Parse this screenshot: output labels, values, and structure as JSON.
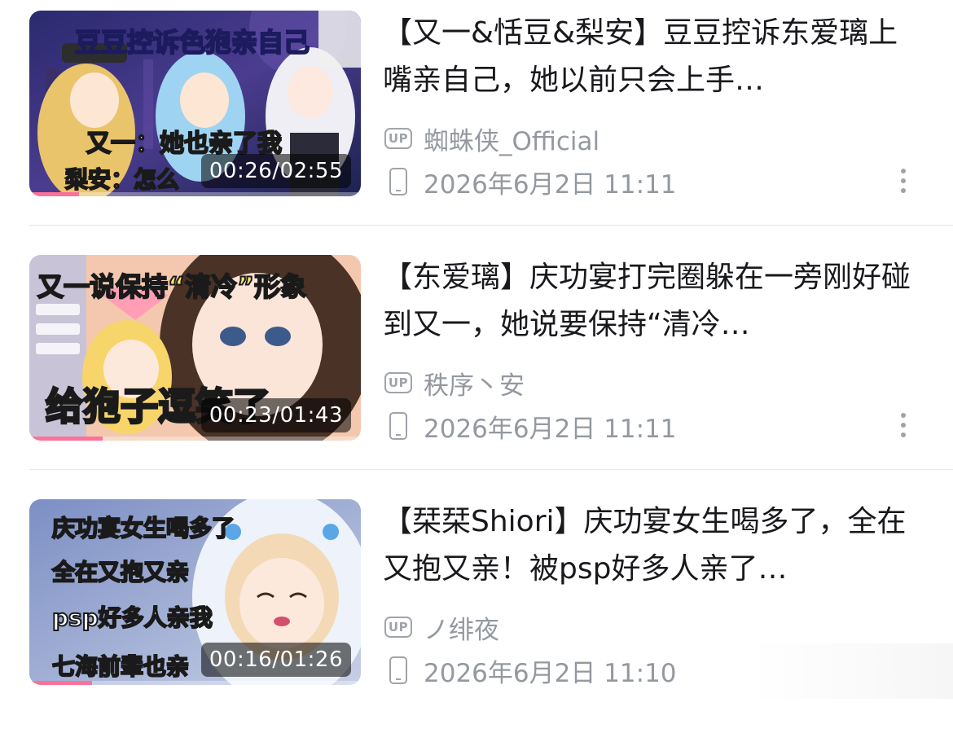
{
  "videos": [
    {
      "thumb_lines": [
        "豆豆控诉色狍亲自己",
        "又一：她也亲了我",
        "梨安：怎么"
      ],
      "duration": "00:26/02:55",
      "watched_fraction": 0.15,
      "title": "【又一&恬豆&梨安】豆豆控诉东爱璃上嘴亲自己，她以前只会上手…",
      "uploader_badge": "UP",
      "uploader": "蜘蛛侠_Official",
      "date": "2026年6月2日 11:11"
    },
    {
      "thumb_lines": [
        "又一说保持“清冷”形象",
        "给狍子逗笑了"
      ],
      "duration": "00:23/01:43",
      "watched_fraction": 0.22,
      "title": "【东爱璃】庆功宴打完圈躲在一旁刚好碰到又一，她说要保持“清冷…",
      "uploader_badge": "UP",
      "uploader": "秩序丶安",
      "date": "2026年6月2日 11:11"
    },
    {
      "thumb_lines": [
        "庆功宴女生喝多了",
        "全在又抱又亲",
        "psp好多人亲我",
        "七海前辈也亲"
      ],
      "duration": "00:16/01:26",
      "watched_fraction": 0.19,
      "title": "【栞栞Shiori】庆功宴女生喝多了，全在又抱又亲！被psp好多人亲了…",
      "uploader_badge": "UP",
      "uploader": "ノ绯夜",
      "date": "2026年6月2日 11:10"
    }
  ],
  "colors": {
    "progress": "#fb7299",
    "meta_text": "#9499a0",
    "title_text": "#18191c"
  },
  "icons": {
    "uploader": "up-badge-icon",
    "date": "phone-icon",
    "more": "more-vertical-icon"
  }
}
